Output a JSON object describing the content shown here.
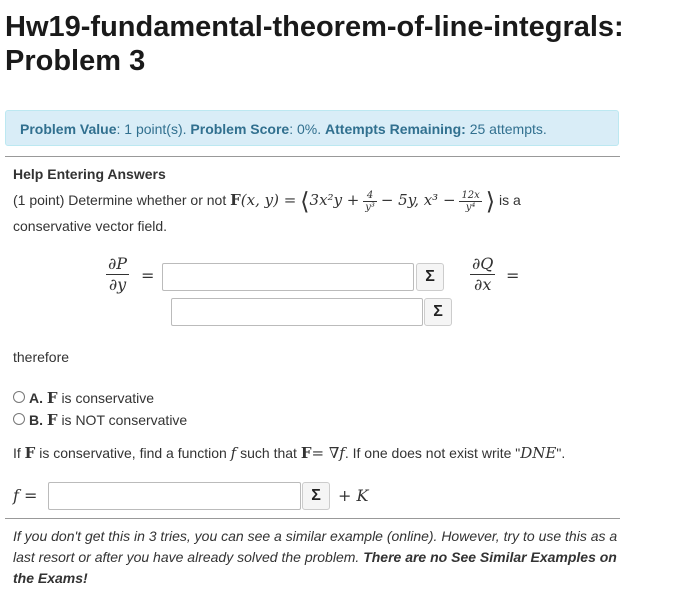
{
  "page": {
    "title": "Hw19-fundamental-theorem-of-line-integrals: Problem 3"
  },
  "info": {
    "value_label": "Problem Value",
    "value_text": ": 1 point(s).",
    "score_label": "Problem Score",
    "score_text": ": 0%.",
    "attempts_label": "Attempts Remaining:",
    "attempts_text": "25 attempts."
  },
  "problem": {
    "help_link": "Help Entering Answers",
    "intro": "(1 point) Determine whether or not",
    "field_F": "F",
    "field_args": "(x, y) =",
    "component1_start": "3x²y +",
    "frac1_num": "4",
    "frac1_den": "y³",
    "component1_end": "− 5y, x³ −",
    "frac2_num": "12x",
    "frac2_den": "y⁴",
    "is_a": "is a",
    "line2": "conservative vector field.",
    "dPdy_num": "∂P",
    "dPdy_den": "∂y",
    "dQdx_num": "∂Q",
    "dQdx_den": "∂x",
    "equals": "=",
    "sigma": "Σ",
    "therefore": "therefore",
    "optA_letter": "A.",
    "optA_text": "is conservative",
    "optB_letter": "B.",
    "optB_text": "is NOT conservative",
    "find_pre": "If",
    "find_mid": "is conservative, find a function",
    "find_f": "f",
    "find_such": "such that",
    "find_eq": "= ∇f",
    "find_post": ". If one does not exist write \"",
    "find_dne": "DNE",
    "find_end": "\".",
    "f_label": "f =",
    "plus_k": "+ K",
    "footer_text": "If you don't get this in 3 tries, you can see a similar example (online). However, try to use this as a last resort or after you have already solved the problem.",
    "footer_bold": "There are no See Similar Examples on the Exams!"
  }
}
